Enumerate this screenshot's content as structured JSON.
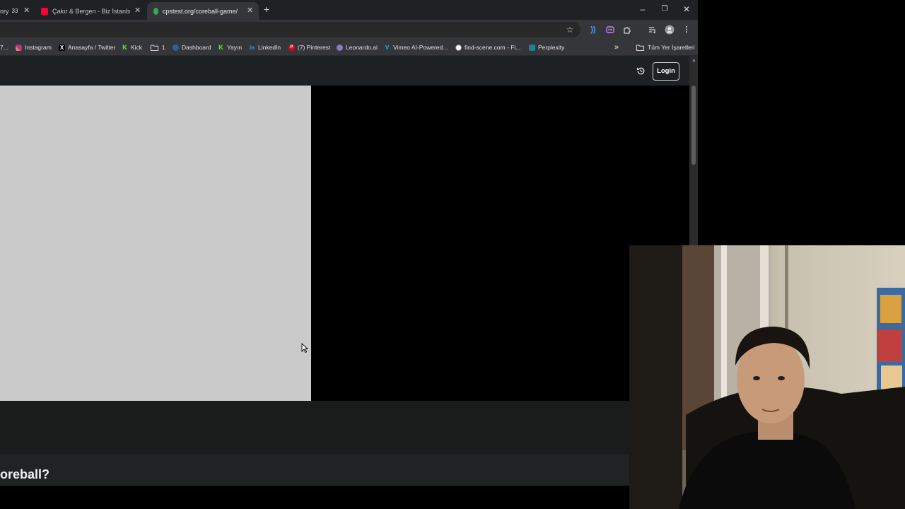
{
  "tabs": [
    {
      "title": "ory",
      "badge": "33",
      "favicon_color": "#555555",
      "active": false
    },
    {
      "title": "Çakır & Bergen - Biz İstanbulla",
      "favicon_color": "#ff0033",
      "active": false
    },
    {
      "title": "cpstest.org/coreball-game/",
      "favicon_color": "#34a853",
      "active": true
    }
  ],
  "window_controls": {
    "minimize": "–",
    "maximize": "❐",
    "close": "✕"
  },
  "new_tab_label": "+",
  "bookmarks": [
    {
      "label": "7...",
      "icon": "folder-icon"
    },
    {
      "label": "Instagram",
      "icon": "instagram-icon",
      "color": "#d62976"
    },
    {
      "label": "Anasayfa / Twitter",
      "icon": "x-icon",
      "color": "#000000",
      "glyph": "X"
    },
    {
      "label": "Kick",
      "icon": "kick-icon",
      "color": "#53fc18",
      "glyph": "K"
    },
    {
      "label": "1",
      "icon": "folder-icon"
    },
    {
      "label": "Dashboard",
      "icon": "dashboard-icon",
      "color": "#3b5998"
    },
    {
      "label": "Yayın",
      "icon": "kick-icon",
      "color": "#53fc18",
      "glyph": "K"
    },
    {
      "label": "LinkedIn",
      "icon": "linkedin-icon",
      "color": "#0a66c2",
      "glyph": "in"
    },
    {
      "label": "(7) Pinterest",
      "icon": "pinterest-icon",
      "color": "#e60023",
      "glyph": "P"
    },
    {
      "label": "Leonardo.ai",
      "icon": "leonardo-icon",
      "color": "#8e7cc3"
    },
    {
      "label": "Vimeo AI-Powered...",
      "icon": "vimeo-icon",
      "color": "#1ab7ea",
      "glyph": "V"
    },
    {
      "label": "find-scene.com - Fi...",
      "icon": "globe-icon",
      "color": "#e0e0e0"
    },
    {
      "label": "Perplexity",
      "icon": "perplexity-icon",
      "color": "#20808d"
    }
  ],
  "bookmarks_overflow": "»",
  "all_bookmarks_label": "Tüm Yer İşaretleri",
  "page": {
    "login_label": "Login",
    "heading_visible": "oreball?"
  },
  "colors": {
    "game_canvas": "#cacaca",
    "header": "#1e2123"
  }
}
